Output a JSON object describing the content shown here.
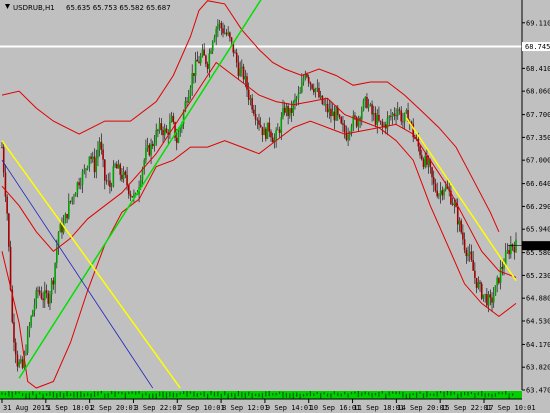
{
  "header": {
    "symbol": "USDRUB,H1",
    "ohlc": "65.635 65.753 65.582 65.687"
  },
  "current_price_label": "65.687",
  "horizontal_line_label": "68.745",
  "colors": {
    "background": "#c0c0c0",
    "candle_up": "#00a000",
    "candle_down": "#a00000",
    "bollinger": "#e00000",
    "trend_green": "#00e000",
    "trend_yellow": "#ffff00",
    "trend_blue": "#2020c0",
    "horizontal_line": "#ffffff"
  },
  "chart_data": {
    "type": "candlestick",
    "title": "USDRUB,H1",
    "ylim": [
      63.47,
      69.46
    ],
    "price_ticks": [
      "69.110",
      "68.745",
      "68.410",
      "68.060",
      "67.700",
      "67.350",
      "67.000",
      "66.640",
      "66.290",
      "65.940",
      "65.580",
      "65.230",
      "64.880",
      "64.530",
      "64.170",
      "63.820",
      "63.470"
    ],
    "time_labels": [
      "31 Aug 2015",
      "1 Sep 18:01",
      "2 Sep 20:01",
      "3 Sep 22:01",
      "7 Sep 10:01",
      "8 Sep 12:01",
      "9 Sep 14:01",
      "10 Sep 16:01",
      "11 Sep 18:01",
      "14 Sep 20:01",
      "15 Sep 22:01",
      "17 Sep 10:01"
    ],
    "close_path": [
      [
        0,
        67.2
      ],
      [
        3,
        66.2
      ],
      [
        6,
        64.5
      ],
      [
        9,
        63.9
      ],
      [
        12,
        63.8
      ],
      [
        15,
        64.3
      ],
      [
        18,
        64.7
      ],
      [
        21,
        65.0
      ],
      [
        24,
        64.9
      ],
      [
        27,
        64.9
      ],
      [
        30,
        65.2
      ],
      [
        33,
        65.9
      ],
      [
        36,
        66.0
      ],
      [
        39,
        66.3
      ],
      [
        42,
        66.5
      ],
      [
        45,
        66.7
      ],
      [
        48,
        66.8
      ],
      [
        51,
        67.1
      ],
      [
        54,
        66.9
      ],
      [
        57,
        67.3
      ],
      [
        60,
        66.7
      ],
      [
        63,
        66.6
      ],
      [
        66,
        66.9
      ],
      [
        69,
        66.8
      ],
      [
        72,
        66.7
      ],
      [
        75,
        66.5
      ],
      [
        78,
        66.4
      ],
      [
        81,
        66.8
      ],
      [
        84,
        67.1
      ],
      [
        87,
        67.2
      ],
      [
        90,
        67.4
      ],
      [
        93,
        67.5
      ],
      [
        96,
        67.4
      ],
      [
        99,
        67.6
      ],
      [
        102,
        67.3
      ],
      [
        105,
        67.6
      ],
      [
        108,
        68.0
      ],
      [
        111,
        68.3
      ],
      [
        114,
        68.5
      ],
      [
        117,
        68.6
      ],
      [
        120,
        68.5
      ],
      [
        123,
        68.9
      ],
      [
        126,
        69.1
      ],
      [
        129,
        69.0
      ],
      [
        132,
        68.9
      ],
      [
        135,
        68.7
      ],
      [
        138,
        68.4
      ],
      [
        141,
        68.3
      ],
      [
        144,
        68.0
      ],
      [
        147,
        67.8
      ],
      [
        150,
        67.6
      ],
      [
        153,
        67.4
      ],
      [
        156,
        67.5
      ],
      [
        159,
        67.3
      ],
      [
        162,
        67.5
      ],
      [
        165,
        67.8
      ],
      [
        168,
        67.7
      ],
      [
        171,
        67.9
      ],
      [
        174,
        68.0
      ],
      [
        177,
        68.4
      ],
      [
        180,
        68.2
      ],
      [
        183,
        68.1
      ],
      [
        186,
        67.9
      ],
      [
        189,
        67.8
      ],
      [
        192,
        67.7
      ],
      [
        195,
        67.7
      ],
      [
        198,
        67.5
      ],
      [
        201,
        67.4
      ],
      [
        204,
        67.6
      ],
      [
        207,
        67.6
      ],
      [
        210,
        67.8
      ],
      [
        213,
        67.9
      ],
      [
        216,
        67.7
      ],
      [
        219,
        67.6
      ],
      [
        222,
        67.5
      ],
      [
        225,
        67.6
      ],
      [
        228,
        67.7
      ],
      [
        231,
        67.8
      ],
      [
        234,
        67.6
      ],
      [
        237,
        67.7
      ],
      [
        240,
        67.4
      ],
      [
        243,
        67.2
      ],
      [
        246,
        67.0
      ],
      [
        249,
        66.9
      ],
      [
        252,
        66.6
      ],
      [
        255,
        66.5
      ],
      [
        258,
        66.6
      ],
      [
        261,
        66.5
      ],
      [
        264,
        66.3
      ],
      [
        267,
        66.0
      ],
      [
        270,
        65.7
      ],
      [
        273,
        65.5
      ],
      [
        276,
        65.2
      ],
      [
        279,
        65.0
      ],
      [
        282,
        64.9
      ],
      [
        285,
        64.8
      ],
      [
        288,
        65.0
      ],
      [
        291,
        65.3
      ],
      [
        294,
        65.5
      ],
      [
        297,
        65.7
      ],
      [
        300,
        65.69
      ]
    ],
    "bollinger_upper": [
      [
        0,
        68.0
      ],
      [
        10,
        68.06
      ],
      [
        20,
        67.8
      ],
      [
        30,
        67.6
      ],
      [
        45,
        67.4
      ],
      [
        60,
        67.6
      ],
      [
        75,
        67.6
      ],
      [
        90,
        67.9
      ],
      [
        100,
        68.3
      ],
      [
        110,
        68.9
      ],
      [
        115,
        69.3
      ],
      [
        120,
        69.45
      ],
      [
        130,
        69.4
      ],
      [
        140,
        69.0
      ],
      [
        150,
        68.7
      ],
      [
        158,
        68.5
      ],
      [
        165,
        68.4
      ],
      [
        175,
        68.3
      ],
      [
        185,
        68.4
      ],
      [
        195,
        68.3
      ],
      [
        205,
        68.15
      ],
      [
        215,
        68.2
      ],
      [
        225,
        68.2
      ],
      [
        235,
        68.0
      ],
      [
        245,
        67.75
      ],
      [
        255,
        67.5
      ],
      [
        265,
        67.2
      ],
      [
        275,
        66.7
      ],
      [
        285,
        66.2
      ],
      [
        290,
        65.9
      ]
    ],
    "bollinger_middle": [
      [
        0,
        66.6
      ],
      [
        10,
        66.3
      ],
      [
        20,
        65.9
      ],
      [
        30,
        65.6
      ],
      [
        40,
        65.8
      ],
      [
        50,
        66.1
      ],
      [
        60,
        66.3
      ],
      [
        70,
        66.5
      ],
      [
        80,
        66.8
      ],
      [
        90,
        67.1
      ],
      [
        100,
        67.5
      ],
      [
        110,
        67.9
      ],
      [
        120,
        68.3
      ],
      [
        125,
        68.5
      ],
      [
        130,
        68.4
      ],
      [
        135,
        68.3
      ],
      [
        140,
        68.2
      ],
      [
        150,
        68.0
      ],
      [
        160,
        67.9
      ],
      [
        170,
        67.85
      ],
      [
        180,
        67.9
      ],
      [
        190,
        67.95
      ],
      [
        200,
        67.7
      ],
      [
        210,
        67.6
      ],
      [
        220,
        67.5
      ],
      [
        230,
        67.55
      ],
      [
        240,
        67.4
      ],
      [
        250,
        67.0
      ],
      [
        260,
        66.6
      ],
      [
        270,
        66.1
      ],
      [
        280,
        65.6
      ],
      [
        290,
        65.3
      ],
      [
        300,
        65.2
      ]
    ],
    "bollinger_lower": [
      [
        0,
        65.6
      ],
      [
        10,
        64.5
      ],
      [
        15,
        63.6
      ],
      [
        20,
        63.5
      ],
      [
        30,
        63.6
      ],
      [
        40,
        64.2
      ],
      [
        50,
        65.0
      ],
      [
        60,
        65.7
      ],
      [
        70,
        66.2
      ],
      [
        80,
        66.4
      ],
      [
        90,
        66.9
      ],
      [
        100,
        67.0
      ],
      [
        110,
        67.2
      ],
      [
        120,
        67.2
      ],
      [
        130,
        67.3
      ],
      [
        140,
        67.2
      ],
      [
        150,
        67.1
      ],
      [
        160,
        67.3
      ],
      [
        170,
        67.5
      ],
      [
        180,
        67.6
      ],
      [
        190,
        67.5
      ],
      [
        200,
        67.4
      ],
      [
        210,
        67.45
      ],
      [
        220,
        67.5
      ],
      [
        230,
        67.3
      ],
      [
        240,
        67.0
      ],
      [
        250,
        66.3
      ],
      [
        260,
        65.7
      ],
      [
        270,
        65.1
      ],
      [
        280,
        64.8
      ],
      [
        290,
        64.6
      ],
      [
        300,
        64.8
      ]
    ],
    "horizontal_level": 68.745,
    "last_price": 65.687
  }
}
